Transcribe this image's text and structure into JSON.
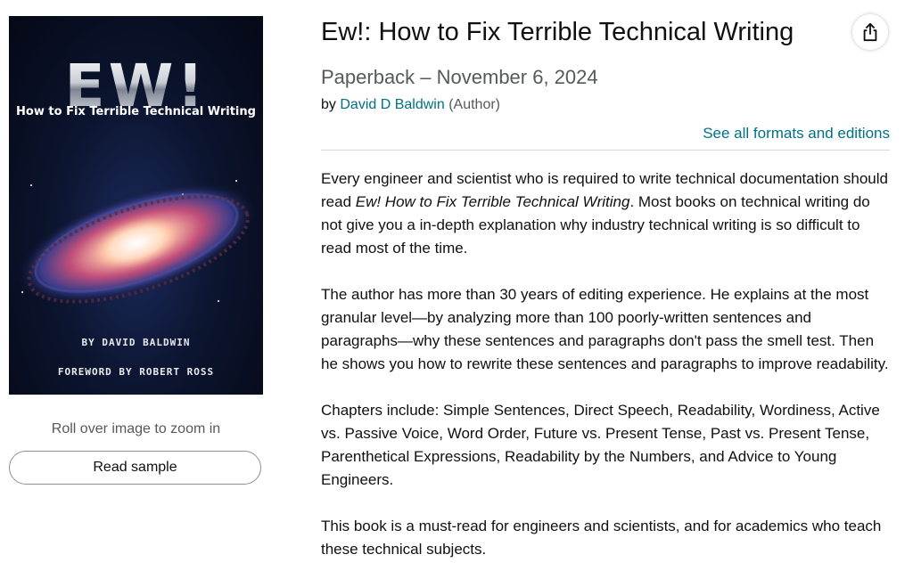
{
  "cover": {
    "logo_text": "EW!",
    "subtitle": "How to Fix Terrible Technical Writing",
    "author_line": "BY DAVID BALDWIN",
    "foreword_line": "FOREWORD BY ROBERT ROSS"
  },
  "image_panel": {
    "zoom_hint": "Roll over image to zoom in",
    "read_sample_label": "Read sample"
  },
  "product": {
    "title": "Ew!: How to Fix Terrible Technical Writing",
    "format_line": "Paperback – November 6, 2024",
    "by_prefix": "by",
    "author_name": "David D Baldwin",
    "author_role": "(Author)",
    "see_all_formats": "See all formats and editions",
    "share_icon": "share-icon"
  },
  "description": {
    "p1_before": "Every engineer and scientist who is required to write technical documentation should read ",
    "p1_italic": "Ew! How to Fix Terrible Technical Writing",
    "p1_after": ". Most books on technical writing do not give you a in-depth explanation why industry technical writing is so difficult to read most of the time.",
    "p2": "The author has more than 30 years of editing experience. He explains at the most granular level—by analyzing more than 100 poorly-written sentences and paragraphs—why these sentences and paragraphs don't pass the smell test. Then he shows you how to rewrite these sentences and paragraphs to improve readability.",
    "p3": "Chapters include: Simple Sentences, Direct Speech, Readability, Wordiness, Active vs. Passive Voice, Word Order, Future vs. Present Tense, Past vs. Present Tense, Parenthetical Expressions, Readability by the Numbers, and Advice to Young Engineers.",
    "p4": "This book is a must-read for engineers and scientists, and for academics who teach these technical subjects."
  },
  "colors": {
    "link": "#007185",
    "text": "#0f1111",
    "muted": "#565959"
  }
}
